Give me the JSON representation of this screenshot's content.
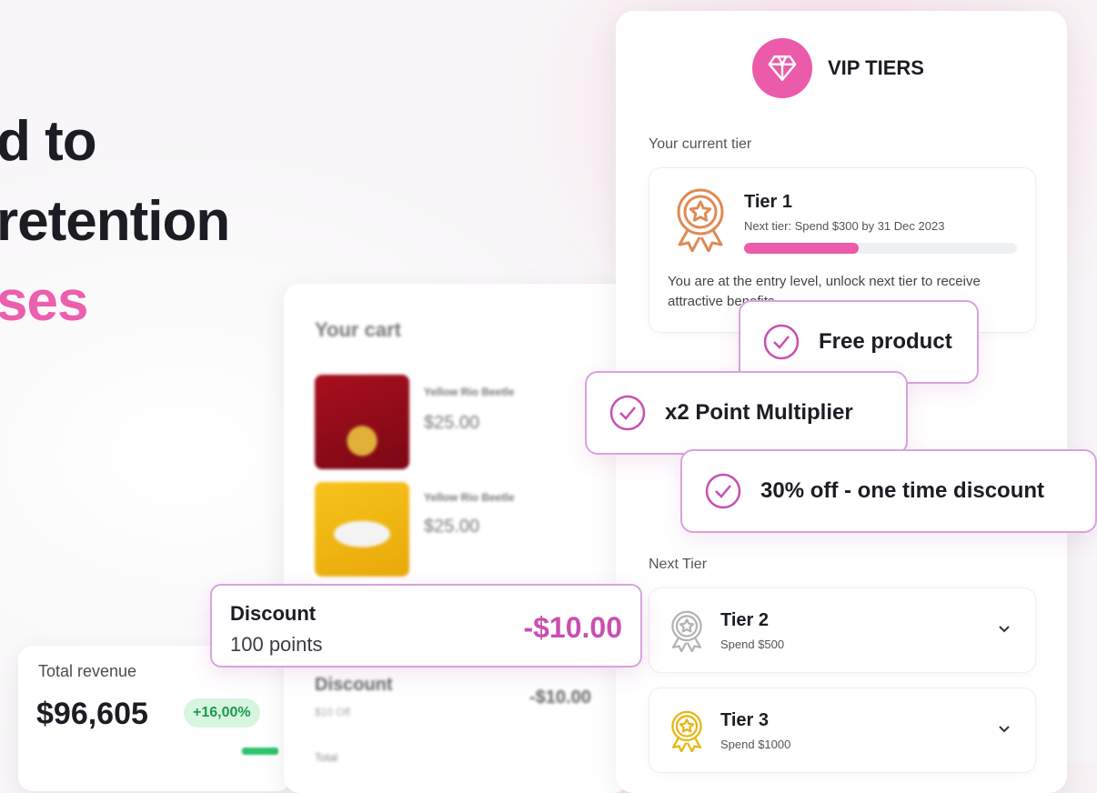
{
  "headline": {
    "line1": "d to",
    "line2": "retention",
    "line3": "ses"
  },
  "revenue": {
    "label": "Total revenue",
    "amount": "$96,605",
    "change": "+16,00%"
  },
  "cart": {
    "title": "Your cart",
    "items": [
      {
        "name": "Yellow Rio Beetle",
        "price": "$25.00"
      },
      {
        "name": "Yellow Rio Beetle",
        "price": "$25.00"
      }
    ],
    "discount_label": "Discount",
    "discount_sub": "$10 Off",
    "discount_value": "-$10.00",
    "total_label": "Total"
  },
  "discount_popup": {
    "title": "Discount",
    "subtitle": "100 points",
    "value": "-$10.00"
  },
  "vip": {
    "title": "VIP TIERS",
    "current_label": "Your current tier",
    "current": {
      "name": "Tier 1",
      "next": "Next tier: Spend $300 by 31 Dec 2023",
      "progress": 0.42,
      "description": "You are at the entry level, unlock next tier to receive attractive benefits"
    },
    "next_label": "Next Tier",
    "tiers": [
      {
        "name": "Tier 2",
        "sub": "Spend $500"
      },
      {
        "name": "Tier 3",
        "sub": "Spend $1000"
      }
    ]
  },
  "benefits": [
    "Free product",
    "x2 Point Multiplier",
    "30% off - one time discount"
  ],
  "colors": {
    "accent": "#ec5aaa",
    "check": "#c94fb0",
    "badge_green": "#1d9a4d",
    "bronze": "#e08a55",
    "silver": "#b3b3b3",
    "gold": "#e8b613"
  },
  "icons": [
    "diamond-icon",
    "award-medal-icon",
    "check-circle-icon",
    "chevron-down-icon"
  ]
}
